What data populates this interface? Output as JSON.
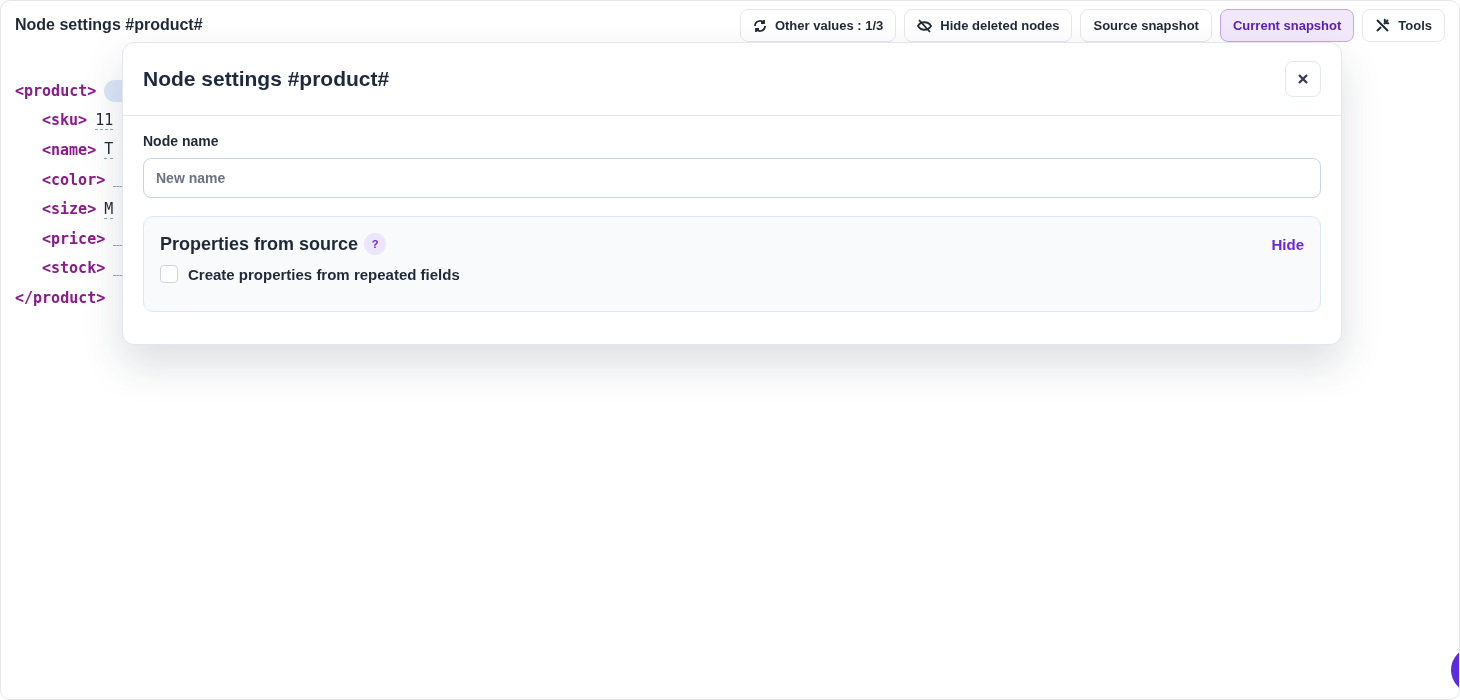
{
  "page": {
    "title": "Node settings #product#"
  },
  "toolbar": [
    {
      "label": "Other values : 1/3",
      "selected": false
    },
    {
      "label": "Hide deleted nodes",
      "selected": false
    },
    {
      "label": "Source snapshot",
      "selected": false
    },
    {
      "label": "Current snapshot",
      "selected": true
    },
    {
      "label": "Tools",
      "selected": false
    }
  ],
  "code": [
    {
      "open": "<product>",
      "badge": true
    },
    {
      "open": "<sku>",
      "value": "11"
    },
    {
      "open": "<name>",
      "value": "T"
    },
    {
      "open": "<color>"
    },
    {
      "open": "<size>",
      "value": "M"
    },
    {
      "open": "<price>"
    },
    {
      "open": "<stock>"
    },
    {
      "open": "</product>"
    }
  ],
  "modal": {
    "title": "Node settings #product#",
    "field": {
      "label": "Node name",
      "placeholder": "New name"
    },
    "section": {
      "title": "Properties from source",
      "help": "?",
      "toggle": "Hide",
      "option": {
        "label": "Create properties from repeated fields",
        "checked": false
      }
    }
  }
}
